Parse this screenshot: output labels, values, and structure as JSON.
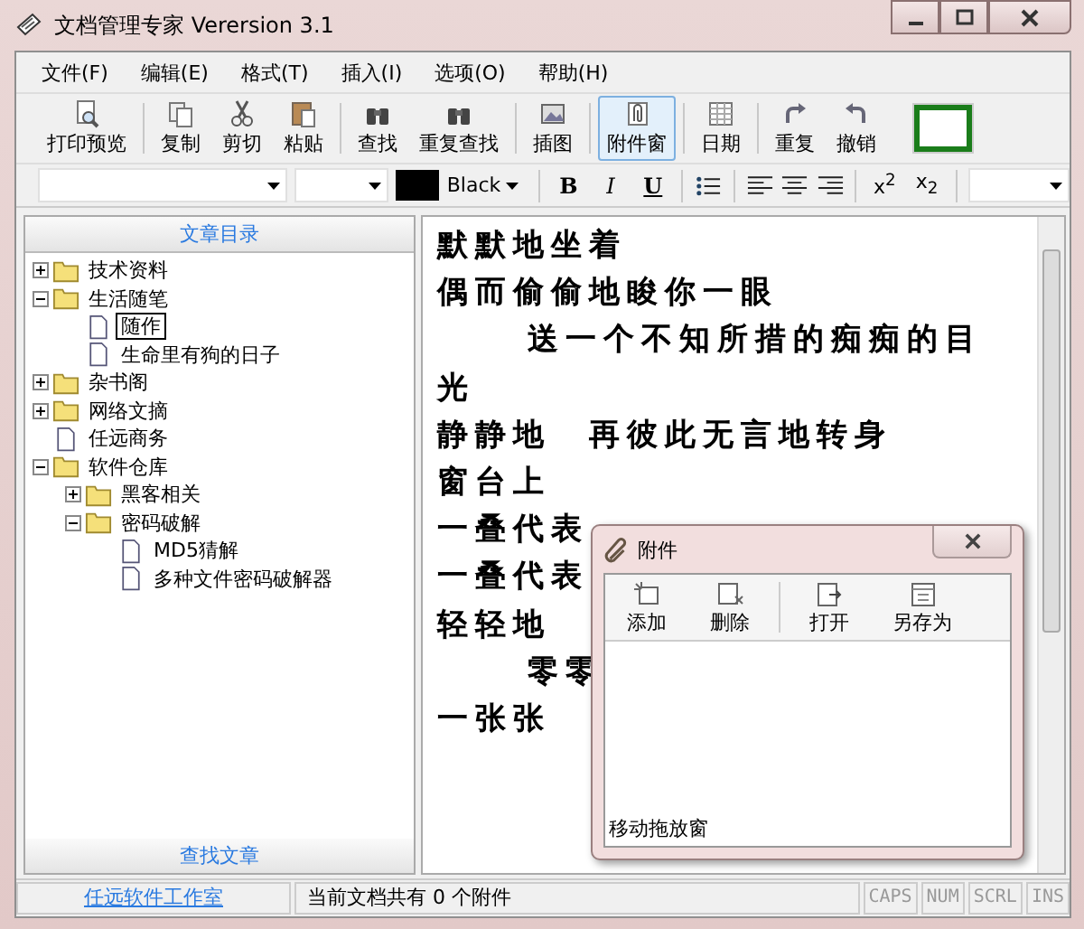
{
  "window": {
    "title": "文档管理专家 Verersion 3.1"
  },
  "menu": [
    "文件(F)",
    "编辑(E)",
    "格式(T)",
    "插入(I)",
    "选项(O)",
    "帮助(H)"
  ],
  "toolbar": [
    {
      "label": "打印预览",
      "pressed": false
    },
    {
      "label": "复制",
      "pressed": false
    },
    {
      "label": "剪切",
      "pressed": false
    },
    {
      "label": "粘贴",
      "pressed": false
    },
    {
      "label": "查找",
      "pressed": false
    },
    {
      "label": "重复查找",
      "pressed": false
    },
    {
      "label": "插图",
      "pressed": false
    },
    {
      "label": "附件窗",
      "pressed": true
    },
    {
      "label": "日期",
      "pressed": false
    },
    {
      "label": "重复",
      "pressed": false
    },
    {
      "label": "撤销",
      "pressed": false
    }
  ],
  "format_bar": {
    "color_name": "Black",
    "styles": [
      "B",
      "I",
      "U"
    ],
    "scripts": [
      "x$^{2}$",
      "x$_{2}$"
    ]
  },
  "sidebar": {
    "title": "文章目录",
    "footer": "查找文章",
    "tree": [
      {
        "label": "技术资料",
        "kind": "folder",
        "expanded": false,
        "selected": false
      },
      {
        "label": "生活随笔",
        "kind": "folder",
        "expanded": true,
        "selected": false,
        "children": [
          {
            "label": "随作",
            "kind": "document",
            "selected": true
          },
          {
            "label": "生命里有狗的日子",
            "kind": "document",
            "selected": false
          }
        ]
      },
      {
        "label": "杂书阁",
        "kind": "folder",
        "expanded": false,
        "selected": false
      },
      {
        "label": "网络文摘",
        "kind": "folder",
        "expanded": false,
        "selected": false
      },
      {
        "label": "任远商务",
        "kind": "document",
        "selected": false
      },
      {
        "label": "软件仓库",
        "kind": "folder",
        "expanded": true,
        "selected": false,
        "children": [
          {
            "label": "黑客相关",
            "kind": "folder",
            "expanded": false,
            "selected": false
          },
          {
            "label": "密码破解",
            "kind": "folder",
            "expanded": true,
            "selected": false,
            "children": [
              {
                "label": "MD5猜解",
                "kind": "document",
                "selected": false
              },
              {
                "label": "多种文件密码破解器",
                "kind": "document",
                "selected": false
              }
            ]
          }
        ]
      }
    ]
  },
  "editor": {
    "lines": [
      {
        "text": "默默地坐着",
        "indented": false
      },
      {
        "text": "偶而偷偷地睃你一眼",
        "indented": false
      },
      {
        "text": "送一个不知所措的痴痴的目",
        "indented": true
      },
      {
        "text": "光",
        "indented": false
      },
      {
        "text": "静静地　再彼此无言地转身",
        "indented": false
      },
      {
        "text": "窗台上",
        "indented": false
      },
      {
        "text": "一叠代表",
        "indented": false
      },
      {
        "text": "一叠代表",
        "indented": false
      },
      {
        "text": "轻轻地",
        "indented": false
      },
      {
        "text": "零零",
        "indented": true
      },
      {
        "text": "一张张",
        "indented": false
      }
    ]
  },
  "attachment_window": {
    "title": "附件",
    "tools": [
      "添加",
      "删除",
      "打开",
      "另存为"
    ],
    "footer": "移动拖放窗"
  },
  "status_bar": {
    "link": "任远软件工作室",
    "message": "当前文档共有 0 个附件",
    "indicators": [
      {
        "label": "CAPS",
        "on": false
      },
      {
        "label": "NUM",
        "on": false
      },
      {
        "label": "SCRL",
        "on": false
      },
      {
        "label": "INS",
        "on": false
      }
    ]
  }
}
